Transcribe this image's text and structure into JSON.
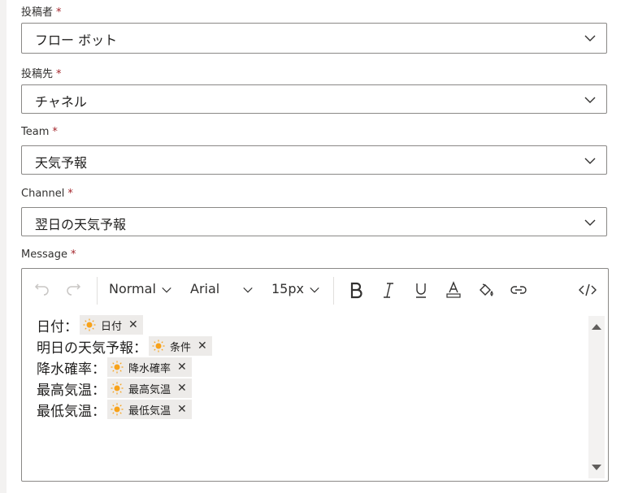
{
  "fields": [
    {
      "label": "投稿者",
      "required": "*",
      "value": "フロー ボット"
    },
    {
      "label": "投稿先",
      "required": "*",
      "value": "チャネル"
    },
    {
      "label": "Team",
      "required": "*",
      "value": "天気予報"
    },
    {
      "label": "Channel",
      "required": "*",
      "value": "翌日の天気予報"
    }
  ],
  "message": {
    "label": "Message",
    "required": "*",
    "toolbar": {
      "style": "Normal",
      "font": "Arial",
      "size": "15px"
    },
    "lines": [
      {
        "text": "日付：",
        "token": "日付"
      },
      {
        "text": "明日の天気予報：",
        "token": "条件"
      },
      {
        "text": "降水確率：",
        "token": "降水確率"
      },
      {
        "text": "最高気温：",
        "token": "最高気温"
      },
      {
        "text": "最低気温：",
        "token": "最低気温"
      }
    ],
    "remove_glyph": "✕"
  },
  "colors": {
    "required": "#a4262c",
    "border": "#8a8886",
    "chip_bg": "#edebe9",
    "sun": "#f7a21b"
  },
  "icons": [
    "chevron-down-icon",
    "undo-icon",
    "redo-icon",
    "bold-icon",
    "italic-icon",
    "underline-icon",
    "font-color-icon",
    "highlight-icon",
    "link-icon",
    "code-view-icon",
    "sun-icon",
    "remove-icon"
  ]
}
